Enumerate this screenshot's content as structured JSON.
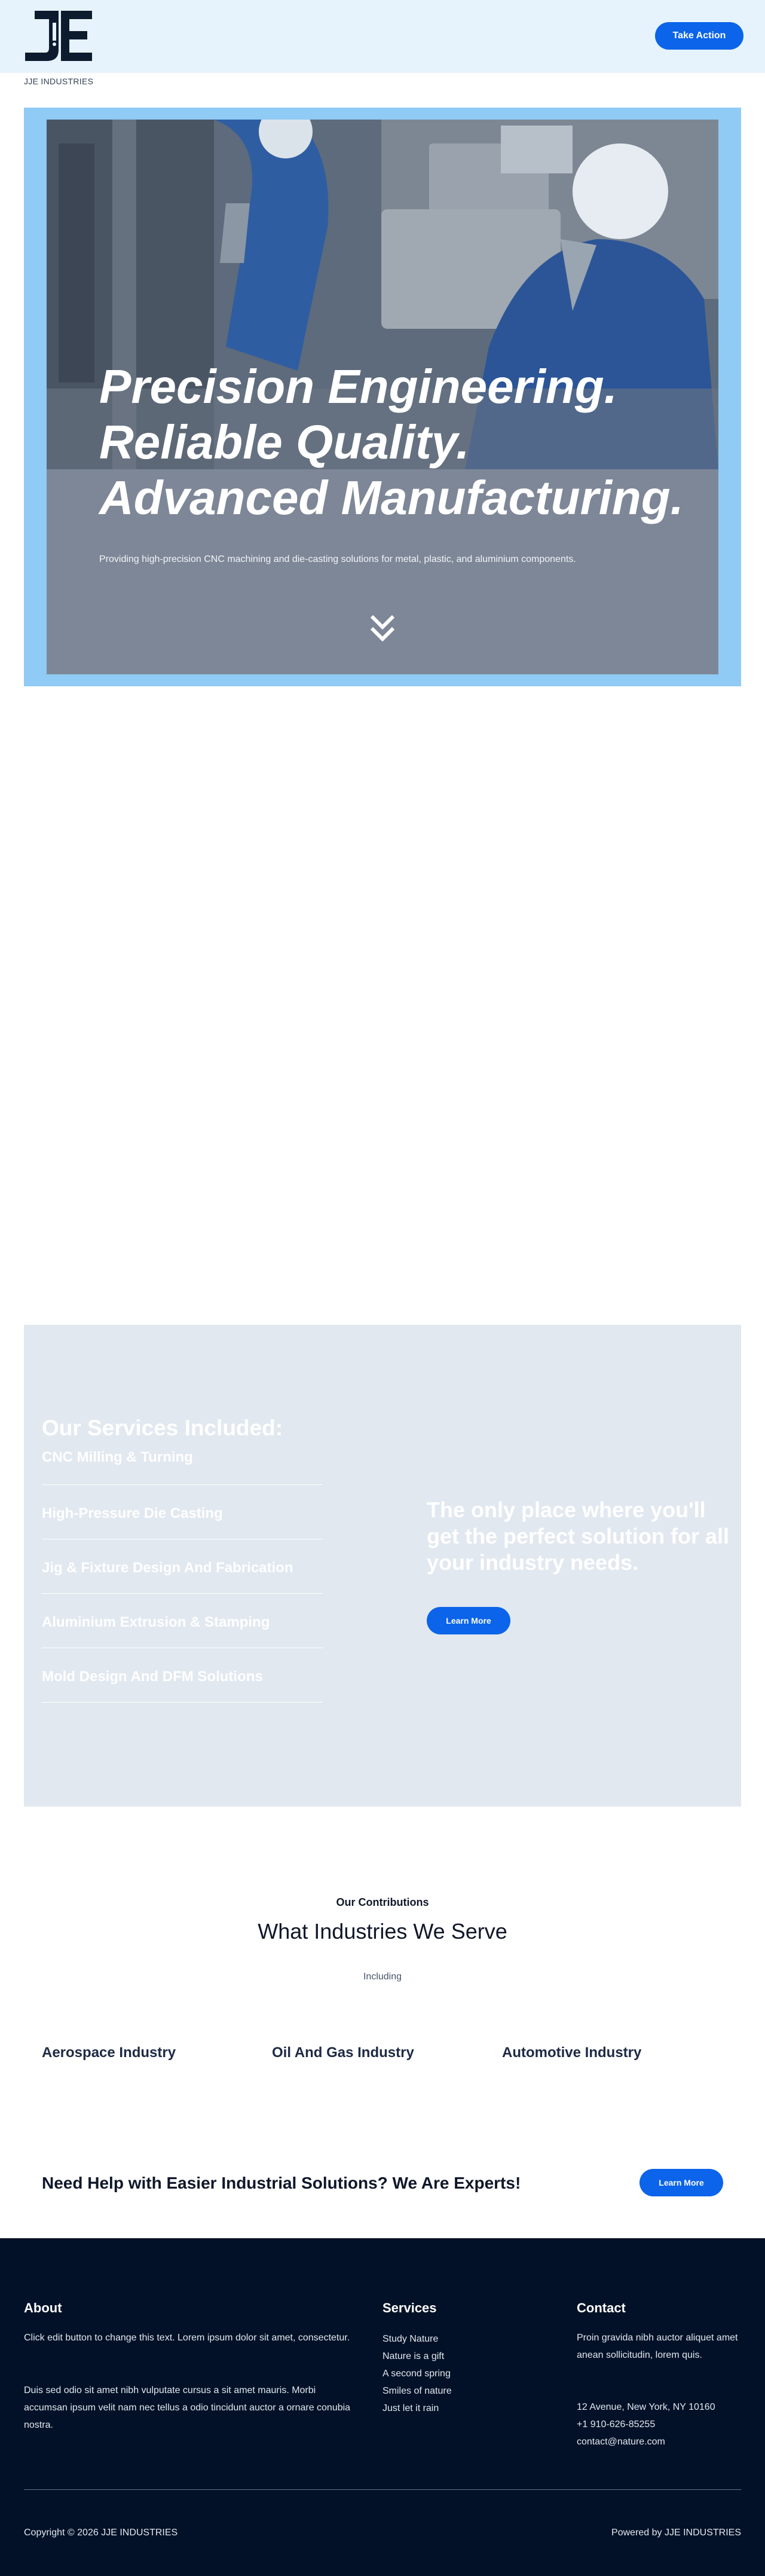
{
  "header": {
    "logo_text": "JJE",
    "cta_label": "Take Action"
  },
  "brand": {
    "name": "JJE INDUSTRIES"
  },
  "hero": {
    "title": "Precision Engineering. Reliable Quality. Advanced Manufacturing.",
    "subtitle": "Providing high-precision CNC machining and die-casting solutions for metal, plastic, and aluminium components."
  },
  "services": {
    "heading": "Our Services Included:",
    "items": [
      "CNC Milling & Turning",
      "High-Pressure Die Casting",
      "Jig & Fixture Design And Fabrication",
      "Aluminium Extrusion & Stamping",
      "Mold Design And DFM Solutions"
    ],
    "tagline": "The only place where you'll get the perfect solution for all your industry needs.",
    "button_label": "Learn More"
  },
  "industries": {
    "kicker": "Our Contributions",
    "title": "What Industries We Serve",
    "subtitle": "Including",
    "items": [
      "Aerospace Industry",
      "Oil And Gas Industry",
      "Automotive Industry"
    ]
  },
  "help": {
    "text": "Need Help with Easier Industrial Solutions? We Are Experts!",
    "button_label": "Learn More"
  },
  "footer": {
    "about": {
      "heading": "About",
      "p1": "Click edit button to change this text. Lorem ipsum dolor sit amet, consectetur.",
      "p2": "Duis sed odio sit amet nibh vulputate cursus a sit amet mauris. Morbi accumsan ipsum velit nam nec tellus a odio tincidunt auctor a ornare conubia nostra."
    },
    "services": {
      "heading": "Services",
      "links": [
        "Study Nature",
        "Nature is a gift",
        "A second spring",
        "Smiles of nature",
        "Just let it rain"
      ]
    },
    "contact": {
      "heading": "Contact",
      "text": "Proin gravida nibh auctor aliquet amet anean sollicitudin, lorem quis.",
      "address": "12 Avenue, New York, NY 10160",
      "phone": "+1 910-626-85255",
      "email": "contact@nature.com"
    },
    "copyright": "Copyright © 2026 JJE INDUSTRIES",
    "powered": "Powered by JJE INDUSTRIES"
  },
  "colors": {
    "accent": "#0b64e9",
    "header_bg": "#e6f3fd",
    "hero_frame": "#8fcbf4",
    "services_bg": "#e2e8f0",
    "footer_bg": "#021127"
  }
}
